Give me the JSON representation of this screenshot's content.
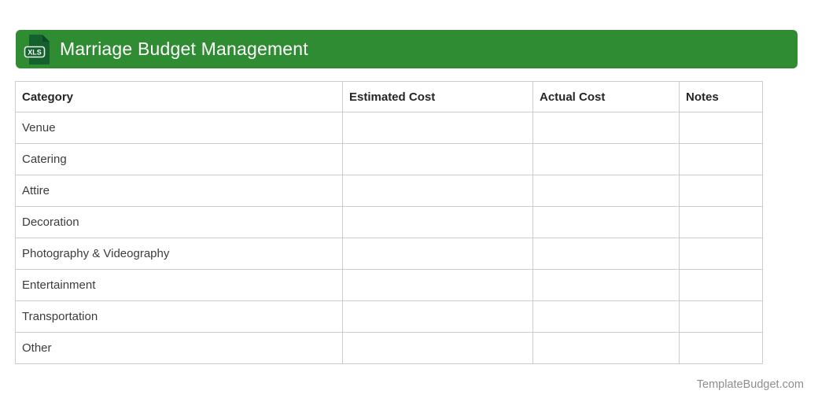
{
  "header": {
    "title": "Marriage Budget Management",
    "icon_label": "XLS"
  },
  "table": {
    "columns": [
      "Category",
      "Estimated Cost",
      "Actual Cost",
      "Notes"
    ],
    "rows": [
      {
        "category": "Venue",
        "estimated_cost": "",
        "actual_cost": "",
        "notes": ""
      },
      {
        "category": "Catering",
        "estimated_cost": "",
        "actual_cost": "",
        "notes": ""
      },
      {
        "category": "Attire",
        "estimated_cost": "",
        "actual_cost": "",
        "notes": ""
      },
      {
        "category": "Decoration",
        "estimated_cost": "",
        "actual_cost": "",
        "notes": ""
      },
      {
        "category": "Photography & Videography",
        "estimated_cost": "",
        "actual_cost": "",
        "notes": ""
      },
      {
        "category": "Entertainment",
        "estimated_cost": "",
        "actual_cost": "",
        "notes": ""
      },
      {
        "category": "Transportation",
        "estimated_cost": "",
        "actual_cost": "",
        "notes": ""
      },
      {
        "category": "Other",
        "estimated_cost": "",
        "actual_cost": "",
        "notes": ""
      }
    ]
  },
  "footer": {
    "credit": "TemplateBudget.com"
  },
  "colors": {
    "header_green": "#2F8C33",
    "icon_dark_green": "#15612E",
    "icon_fold_green": "#0D4C22",
    "table_border": "#CCCCCC",
    "title_text": "#FFFFFF",
    "cell_text": "#3C3C3C",
    "footer_text": "#8E8E8E"
  }
}
